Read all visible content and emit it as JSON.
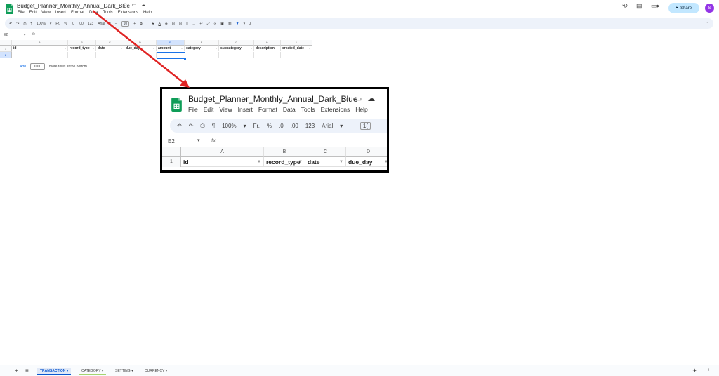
{
  "app": {
    "doc_title": "Budget_Planner_Monthly_Annual_Dark_Blue",
    "menus": [
      "File",
      "Edit",
      "View",
      "Insert",
      "Format",
      "Data",
      "Tools",
      "Extensions",
      "Help"
    ],
    "share_label": "Share",
    "avatar_initial": "S",
    "accent_color": "#0b57d0"
  },
  "toolbar": {
    "zoom": "100%",
    "currency": "Fr.",
    "percent": "%",
    "dec_decrease": ".0",
    "dec_increase": ".00",
    "format_123": "123",
    "font": "Arial",
    "font_size": "10",
    "minus": "−",
    "plus": "+",
    "bold": "B",
    "italic": "I",
    "strike": "S",
    "text_color": "A",
    "sum": "Σ"
  },
  "formula": {
    "name_box": "E2",
    "fx": "fx"
  },
  "sheet": {
    "columns": [
      "A",
      "B",
      "C",
      "D",
      "E",
      "F",
      "G",
      "H",
      "I"
    ],
    "headers": [
      "id",
      "record_type",
      "date",
      "due_day",
      "amount",
      "category",
      "subcategory",
      "description",
      "created_date"
    ],
    "rows": [
      "1",
      "2"
    ]
  },
  "add_rows": {
    "add_label": "Add",
    "count": "1000",
    "suffix": "more rows at the bottom"
  },
  "tabs": [
    {
      "label": "TRANSACTION",
      "arrow": "▾"
    },
    {
      "label": "CATEGORY",
      "arrow": "▾"
    },
    {
      "label": "SETTING",
      "arrow": "▾"
    },
    {
      "label": "CURRENCY",
      "arrow": "▾"
    }
  ],
  "zoom_callout": {
    "doc_title": "Budget_Planner_Monthly_Annual_Dark_Blue",
    "menus": [
      "File",
      "Edit",
      "View",
      "Insert",
      "Format",
      "Data",
      "Tools",
      "Extensions",
      "Help"
    ],
    "toolbar_zoom": "100%",
    "currency": "Fr.",
    "percent": "%",
    "dec_decrease": ".0",
    "dec_increase": ".00",
    "format_123": "123",
    "font": "Arial",
    "minus": "−",
    "font_size_partial": "1(",
    "name_box": "E2",
    "fx": "fx",
    "columns": [
      "A",
      "B",
      "C",
      "D"
    ],
    "headers": [
      "id",
      "record_type",
      "date",
      "due_day"
    ],
    "row": "1"
  },
  "icons": {
    "star": "star-icon",
    "folder": "move-folder-icon",
    "cloud": "cloud-saved-icon",
    "history": "history-icon",
    "comment": "comment-icon",
    "video": "meet-icon",
    "lock": "lock-icon"
  }
}
